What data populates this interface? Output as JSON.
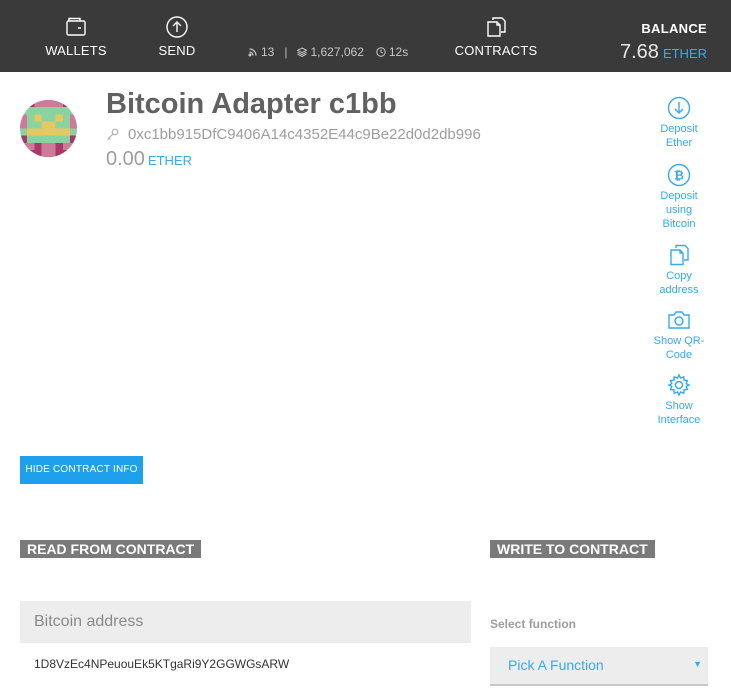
{
  "header": {
    "nav": {
      "wallets_label": "WALLETS",
      "send_label": "SEND",
      "contracts_label": "CONTRACTS"
    },
    "status": {
      "peers": "13",
      "block": "1,627,062",
      "time": "12s",
      "separator": "|"
    },
    "balance": {
      "label": "BALANCE",
      "value": "7.68",
      "unit": "ETHER"
    }
  },
  "account": {
    "title": "Bitcoin Adapter c1bb",
    "address": "0xc1bb915DfC9406A14c4352E44c9Be22d0d2db996",
    "balance_value": "0.00",
    "balance_unit": "ETHER",
    "identicon_icon": "identicon-avatar"
  },
  "actions": [
    {
      "icon": "arrow-down-circle-icon",
      "line1": "Deposit",
      "line2": "Ether",
      "line3": ""
    },
    {
      "icon": "bitcoin-icon",
      "line1": "Deposit",
      "line2": "using",
      "line3": "Bitcoin"
    },
    {
      "icon": "copy-icon",
      "line1": "Copy",
      "line2": "address",
      "line3": ""
    },
    {
      "icon": "camera-icon",
      "line1": "Show QR-",
      "line2": "Code",
      "line3": ""
    },
    {
      "icon": "gear-icon",
      "line1": "Show",
      "line2": "Interface",
      "line3": ""
    }
  ],
  "hide_button_label": "HIDE CONTRACT INFO",
  "read": {
    "heading": "READ FROM CONTRACT",
    "field_label": "Bitcoin address",
    "field_value": "1D8VzEc4NPeuouEk5KTgaRi9Y2GGWGsARW"
  },
  "write": {
    "heading": "WRITE TO CONTRACT",
    "select_label": "Select function",
    "select_value": "Pick A Function",
    "select_arrow": "▼"
  },
  "colors": {
    "header_bg": "#3a3a3a",
    "accent": "#34aaf2",
    "button_bg": "#1fa0ed",
    "section_heading_bg": "#7a7a7a"
  }
}
